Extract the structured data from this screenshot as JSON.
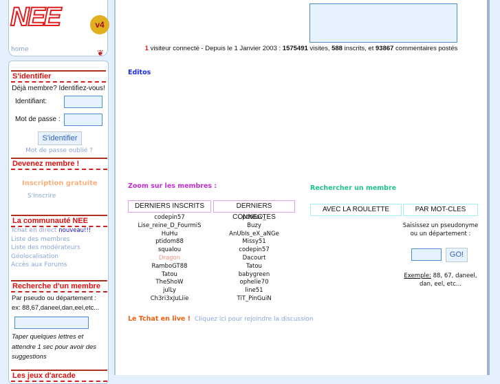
{
  "logo": {
    "text": "NEE",
    "badge": "v4"
  },
  "nav": {
    "home": "home"
  },
  "login": {
    "title": "S'identifier",
    "intro": "Déjà membre? Identifiez-vous!",
    "id_label": "Identifiant:",
    "pw_label": "Mot de passe :",
    "submit": "S'identifier",
    "forgot": "Mot de passe oublié ?"
  },
  "join": {
    "title": "Devenez membre !",
    "free": "Inscription gratuite",
    "signup": "S'inscrire"
  },
  "community": {
    "title": "La communauté NEE",
    "chat": "Tchat en direct",
    "new": "nouveau!!!",
    "links": [
      "Liste des membres",
      "Liste des modérateurs",
      "Géolocalisation",
      "Accès aux Forums"
    ]
  },
  "search_side": {
    "title": "Recherche d'un membre",
    "help1": "Par pseudo ou département :",
    "help2": "ex: 88,67,daneel,dan,eel,etc...",
    "hint": "Taper quelques lettres et attendre 1 sec pour avoir des suggestions"
  },
  "next_section": {
    "title": "Les jeux d'arcade"
  },
  "stats": {
    "online": "1",
    "t1": " visiteur connecté - Depuis le 1 Janvier 2003 : ",
    "visits": "1575491",
    "t2": " visites, ",
    "members": "588",
    "t3": " inscrits, et ",
    "comments": "93867",
    "t4": " commentaires postés"
  },
  "editos": "Editos",
  "zoom": {
    "title": "Zoom sur les membres :",
    "tab_new": "DERNIERS INSCRITS",
    "tab_connected": "DERNIERS CONNECTES",
    "new_members": [
      "codepin57",
      "Lise_reine_D_FourmiS",
      "HuHu",
      "ptidom88",
      "squalou",
      "Dragon",
      "RamboGT88",
      "Tatou",
      "TheShoW",
      "julLy",
      "Ch3ri3xJuLiie"
    ],
    "connected": [
      "ptitdav_",
      "Buzy",
      "AnUbIs_eX_aNGe",
      "Missy51",
      "codepin57",
      "Dacourt",
      "Tatou",
      "babygreen",
      "ophelie70",
      "line51",
      "TiT_PinGuiN"
    ]
  },
  "chat": {
    "title": "Le Tchat en live !",
    "link": "Cliquez ici pour rejoindre la discussion"
  },
  "search_main": {
    "title": "Rechercher un membre",
    "tab_roulette": "AVEC LA ROULETTE",
    "tab_keywords": "PAR MOT-CLES",
    "prompt1": "Saisissez un pseudonyme",
    "prompt2": "ou un département :",
    "go": "GO!",
    "example_label": "Exemple:",
    "example1": " 88, 67, daneel,",
    "example2": "dan, eel, etc..."
  }
}
